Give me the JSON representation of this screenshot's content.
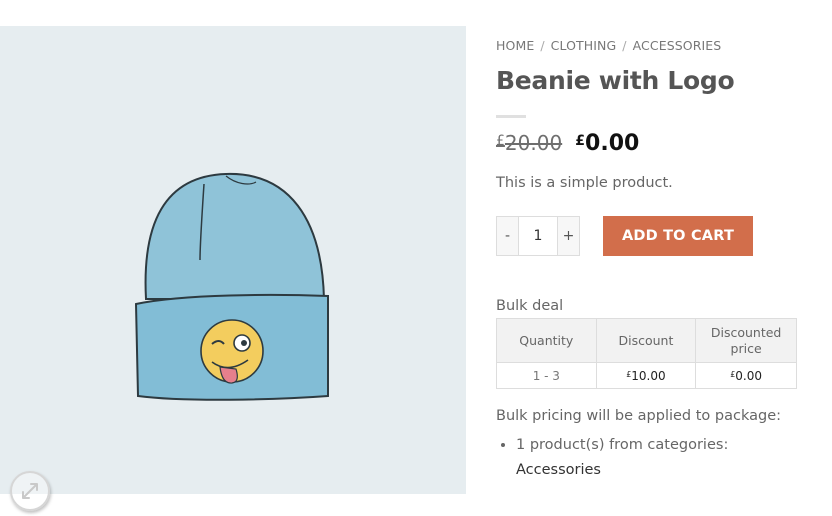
{
  "breadcrumb": {
    "items": [
      "HOME",
      "CLOTHING",
      "ACCESSORIES"
    ],
    "separator": "/"
  },
  "product": {
    "title": "Beanie with Logo",
    "currency_symbol": "£",
    "old_price": "20.00",
    "new_price": "0.00",
    "description": "This is a simple product."
  },
  "cart": {
    "minus_label": "-",
    "quantity": "1",
    "plus_label": "+",
    "add_to_cart_label": "ADD TO CART",
    "button_color": "#d26e4b"
  },
  "bulk": {
    "title": "Bulk deal",
    "headers": [
      "Quantity",
      "Discount",
      "Discounted price"
    ],
    "rows": [
      {
        "range": "1 - 3",
        "discount": "10.00",
        "price": "0.00"
      }
    ],
    "note": "Bulk pricing will be applied to package:",
    "rule_text": "1 product(s) from categories:",
    "category_link": "Accessories"
  },
  "gallery": {
    "background": "#e6edf0",
    "expand_icon": "expand-arrows-icon"
  }
}
